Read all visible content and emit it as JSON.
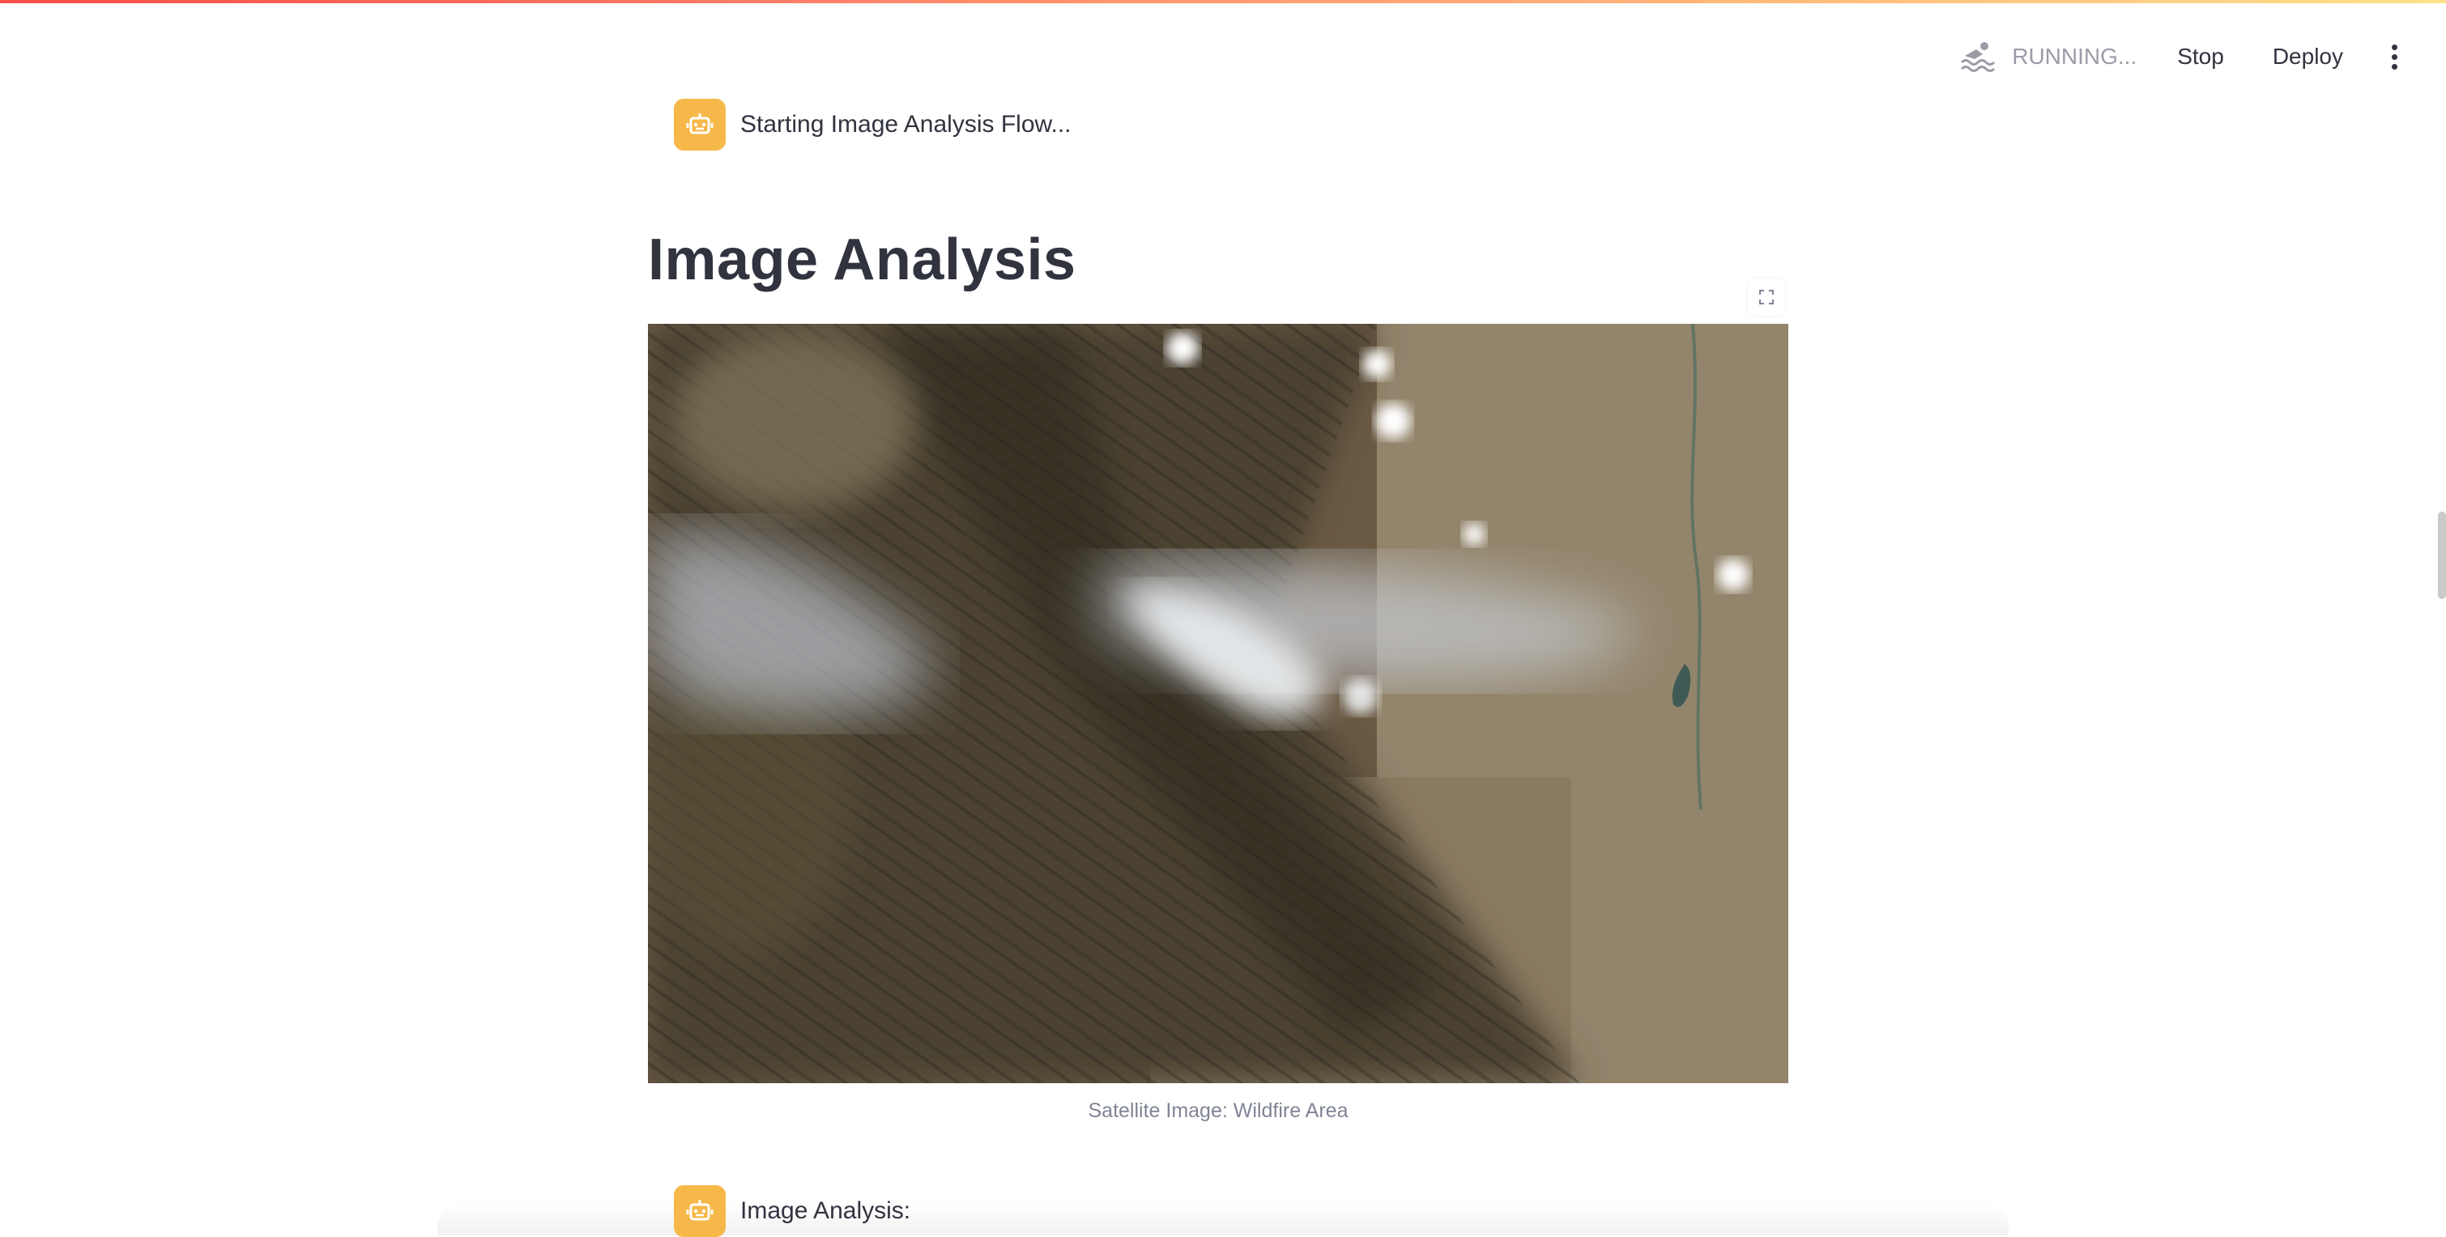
{
  "header": {
    "status_text": "RUNNING...",
    "status_icon": "swimmer-icon",
    "stop_label": "Stop",
    "deploy_label": "Deploy",
    "menu_icon": "vertical-dots-icon"
  },
  "chat": {
    "avatar_icon": "robot-icon",
    "avatar_color": "#f7b84a",
    "messages": [
      {
        "text": "Starting Image Analysis Flow..."
      },
      {
        "text": "Image Analysis:"
      }
    ]
  },
  "main": {
    "title": "Image Analysis",
    "image_caption": "Satellite Image: Wildfire Area"
  },
  "colors": {
    "accent_gradient_start": "#ff4b4b",
    "accent_gradient_end": "#ffe08a",
    "text": "#31333f",
    "muted": "#808495"
  }
}
